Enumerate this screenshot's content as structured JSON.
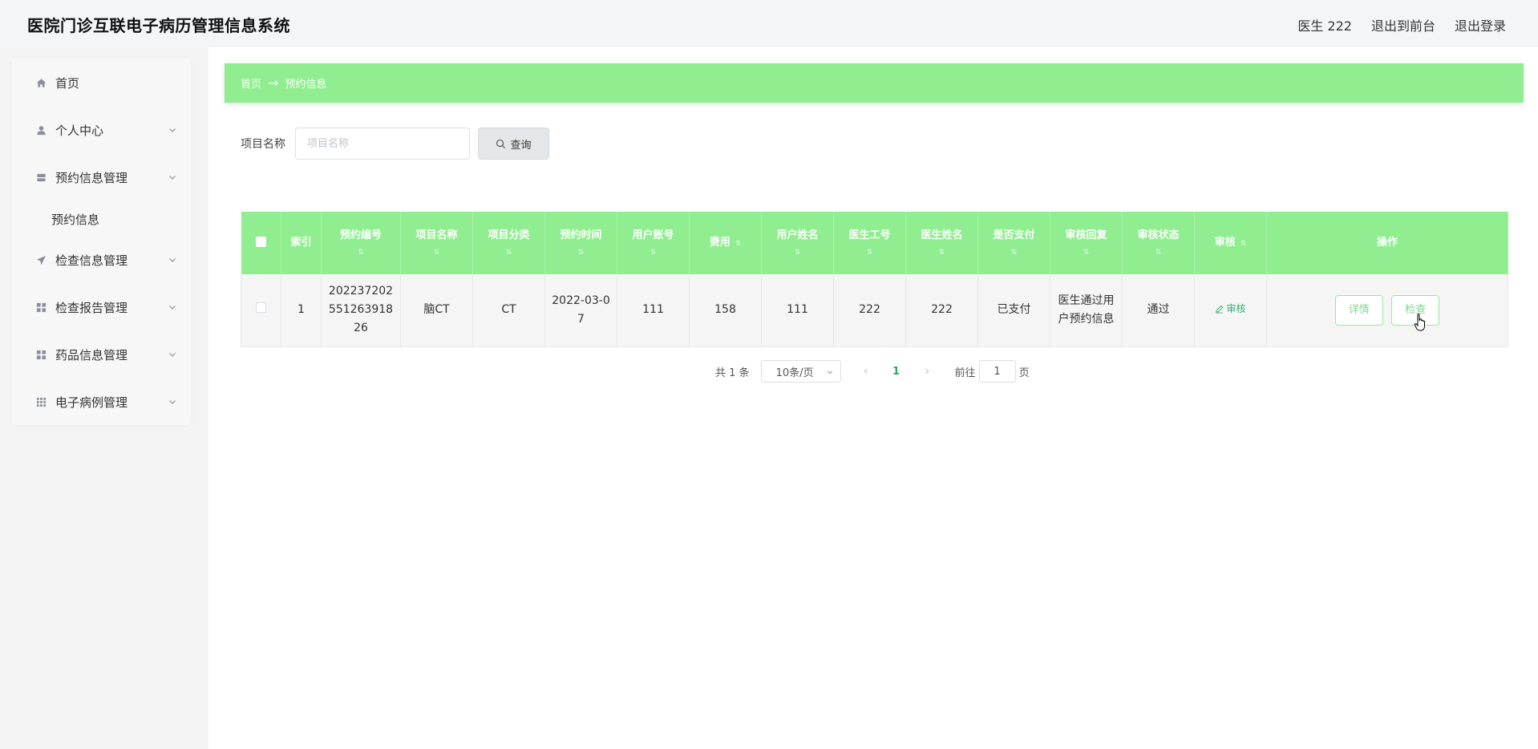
{
  "header": {
    "title": "医院门诊互联电子病历管理信息系统",
    "user": "医生 222",
    "back_to_front": "退出到前台",
    "logout": "退出登录"
  },
  "sidebar": {
    "items": [
      {
        "label": "首页",
        "icon": "home-icon"
      },
      {
        "label": "个人中心",
        "icon": "user-icon"
      },
      {
        "label": "预约信息管理",
        "icon": "calendar-icon"
      },
      {
        "label": "预约信息",
        "icon": ""
      },
      {
        "label": "检查信息管理",
        "icon": "send-icon"
      },
      {
        "label": "检查报告管理",
        "icon": "grid-icon"
      },
      {
        "label": "药品信息管理",
        "icon": "grid-icon"
      },
      {
        "label": "电子病例管理",
        "icon": "apps-icon"
      }
    ]
  },
  "breadcrumb": {
    "home": "首页",
    "separator": "→",
    "current": "预约信息"
  },
  "search": {
    "label": "项目名称",
    "placeholder": "项目名称",
    "button": "查询"
  },
  "table": {
    "columns": [
      "索引",
      "预约编号",
      "项目名称",
      "项目分类",
      "预约时间",
      "用户账号",
      "费用",
      "用户姓名",
      "医生工号",
      "医生姓名",
      "是否支付",
      "审核回复",
      "审核状态",
      "审核",
      "操作"
    ],
    "rows": [
      {
        "index": "1",
        "booking_no": "202237202551263918 26",
        "project_name": "脑CT",
        "project_type": "CT",
        "booking_time": "2022-03-07",
        "user_account": "111",
        "fee": "158",
        "user_name": "111",
        "doctor_id": "222",
        "doctor_name": "222",
        "paid": "已支付",
        "audit_reply": "医生通过用户预约信息",
        "audit_status": "通过",
        "audit_action": "审核",
        "detail_btn": "详情",
        "check_btn": "检查"
      }
    ]
  },
  "pagination": {
    "total": "共 1 条",
    "page_size": "10条/页",
    "current_page": "1",
    "goto_label": "前往",
    "goto_value": "1",
    "page_suffix": "页"
  },
  "colors": {
    "accent": "#90ee90",
    "link": "#35b06b"
  }
}
